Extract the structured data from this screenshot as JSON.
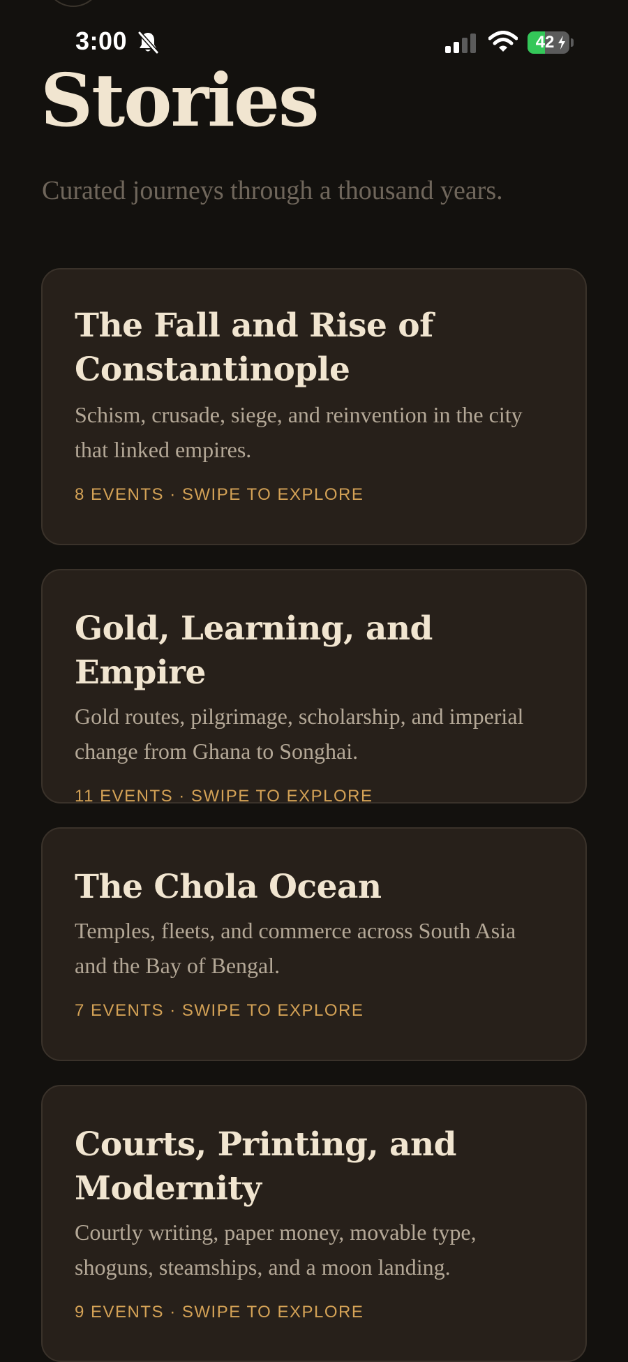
{
  "status_bar": {
    "time": "3:00",
    "battery_level": "42",
    "battery_fraction": 0.42
  },
  "header": {
    "title": "Stories",
    "subtitle": "Curated journeys through a thousand years."
  },
  "stories": [
    {
      "title": "The Fall and Rise of Constantinople",
      "description": "Schism, crusade, siege, and reinvention in the city that linked empires.",
      "meta": "8 EVENTS · SWIPE TO EXPLORE"
    },
    {
      "title": "Gold, Learning, and Empire",
      "description": "Gold routes, pilgrimage, scholarship, and imperial change from Ghana to Songhai.",
      "meta": "11 EVENTS · SWIPE TO EXPLORE"
    },
    {
      "title": "The Chola Ocean",
      "description": "Temples, fleets, and commerce across South Asia and the Bay of Bengal.",
      "meta": "7 EVENTS · SWIPE TO EXPLORE"
    },
    {
      "title": "Courts, Printing, and Modernity",
      "description": "Courtly writing, paper money, movable type, shoguns, steamships, and a moon landing.",
      "meta": "9 EVENTS · SWIPE TO EXPLORE"
    }
  ],
  "colors": {
    "background": "#13110e",
    "card": "#27201a",
    "title": "#f1e5d0",
    "accent": "#d4a256"
  },
  "icons": {
    "bell": "bell-slash-icon",
    "signal": "cellular-signal-icon",
    "wifi": "wifi-icon",
    "battery": "battery-icon"
  }
}
